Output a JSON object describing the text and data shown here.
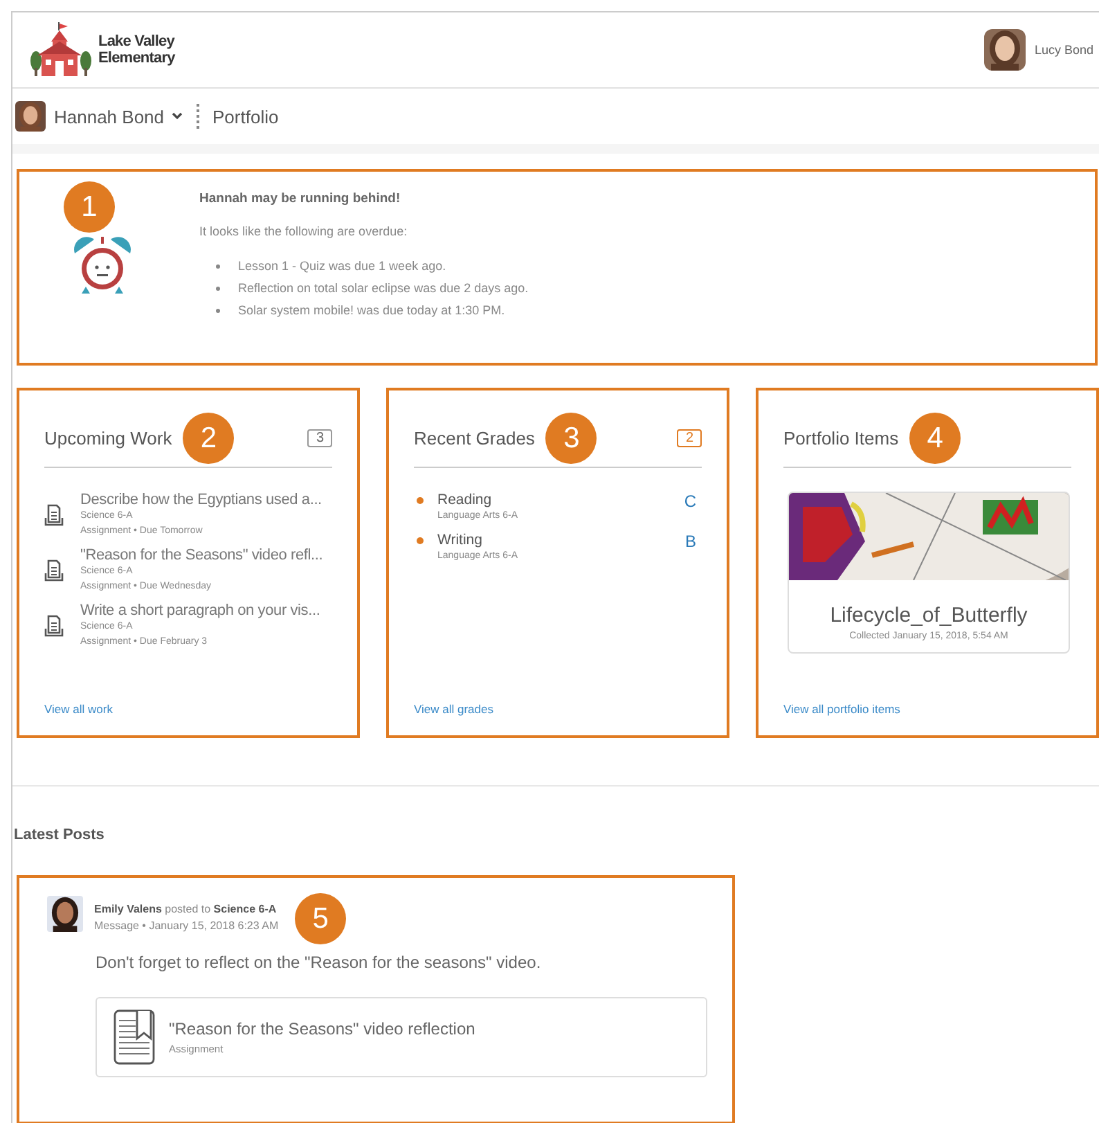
{
  "header": {
    "school_name": [
      "Lake Valley",
      "Elementary"
    ],
    "user_name": "Lucy Bond"
  },
  "nav": {
    "student": "Hannah Bond",
    "section": "Portfolio"
  },
  "alert": {
    "badge": "1",
    "title": "Hannah may be running behind!",
    "intro": "It looks like the following are overdue:",
    "items": [
      "Lesson 1 - Quiz was due 1 week ago.",
      "Reflection on total solar eclipse was due 2 days ago.",
      "Solar system mobile! was due today at 1:30 PM."
    ]
  },
  "upcoming": {
    "title": "Upcoming Work",
    "badge": "2",
    "count": {
      "text": "3",
      "highlighted": false
    },
    "items": [
      {
        "title": "Describe how the Egyptians used a...",
        "course": "Science 6-A",
        "detail": "Assignment • Due Tomorrow"
      },
      {
        "title": "\"Reason for the Seasons\" video refl...",
        "course": "Science 6-A",
        "detail": "Assignment • Due Wednesday"
      },
      {
        "title": "Write a short paragraph on your vis...",
        "course": "Science 6-A",
        "detail": "Assignment • Due February 3"
      }
    ],
    "link": "View all work"
  },
  "grades": {
    "title": "Recent Grades",
    "badge": "3",
    "count": {
      "text": "2",
      "highlighted": true
    },
    "items": [
      {
        "title": "Reading",
        "course": "Language Arts 6-A",
        "grade": "C"
      },
      {
        "title": "Writing",
        "course": "Language Arts 6-A",
        "grade": "B"
      }
    ],
    "link": "View all grades"
  },
  "portfolio": {
    "title": "Portfolio Items",
    "badge": "4",
    "item": {
      "kind": "picture",
      "title": "Lifecycle_of_Butterfly",
      "collected": "Collected January 15, 2018, 5:54 AM"
    },
    "link": "View all portfolio items"
  },
  "posts": {
    "title": "Latest Posts",
    "items": [
      {
        "badge": "5",
        "byline": "**Emily Valens** posted to **Science 6-A**",
        "meta": "Message • January 15, 2018 6:23 AM",
        "body": "Don't forget to reflect on the \"Reason for the seasons\" video.",
        "attachment": {
          "title": "\"Reason for the Seasons\" video reflection",
          "type": "Assignment"
        }
      }
    ]
  }
}
